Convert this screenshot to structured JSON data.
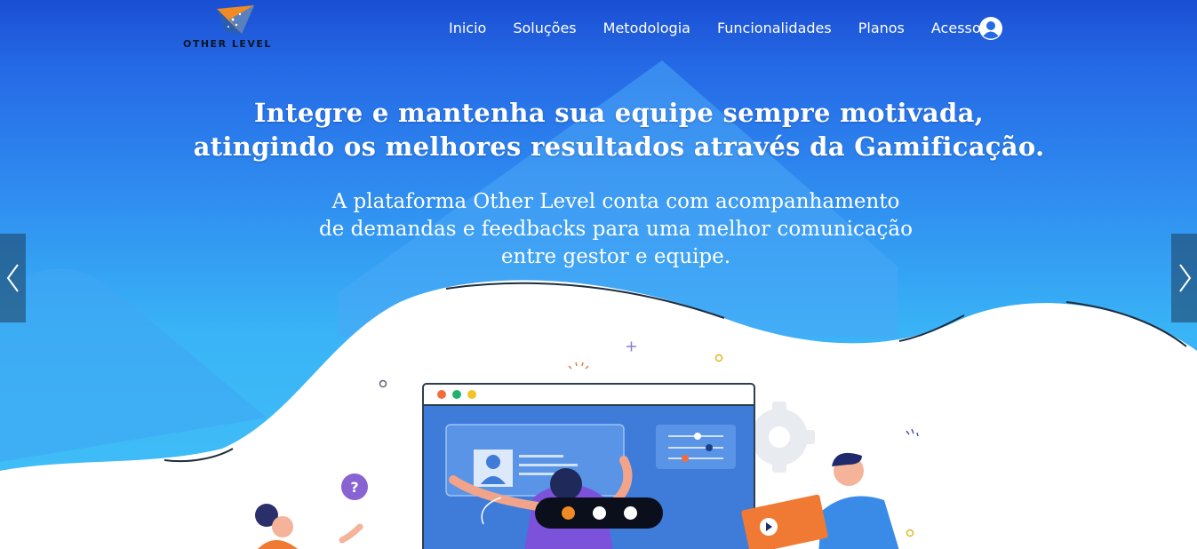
{
  "brand": {
    "name": "Other Level",
    "logo_text": "OTHER LEVEL"
  },
  "nav": {
    "items": [
      {
        "label": "Inicio"
      },
      {
        "label": "Soluções"
      },
      {
        "label": "Metodologia"
      },
      {
        "label": "Funcionalidades"
      },
      {
        "label": "Planos"
      },
      {
        "label": "Acesso"
      }
    ],
    "account_icon": "user-circle-icon"
  },
  "hero": {
    "headline_line1": "Integre e mantenha sua equipe sempre motivada,",
    "headline_line2": "atingindo os melhores resultados através da Gamificação.",
    "sub_line1": "A plataforma Other Level conta com acompanhamento",
    "sub_line2": "de demandas e feedbacks para uma melhor comunicação",
    "sub_line3": "entre gestor e equipe."
  },
  "carousel": {
    "prev_icon": "chevron-left-icon",
    "next_icon": "chevron-right-icon",
    "slide_count": 3,
    "active_index": 0
  },
  "colors": {
    "accent": "#f08a24",
    "hero_top": "#1a4fd3",
    "hero_bottom": "#43c3f8",
    "dots_bg": "#0b0f1c"
  }
}
